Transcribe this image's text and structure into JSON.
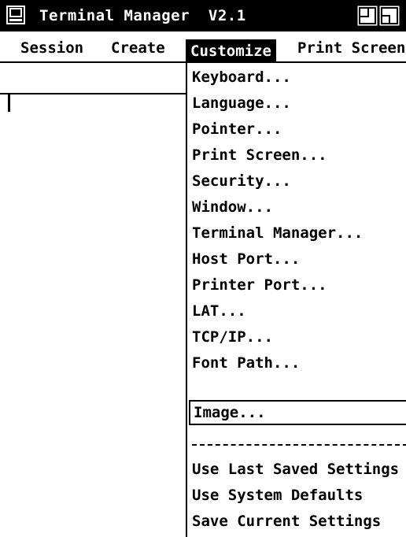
{
  "window": {
    "title": "Terminal Manager  V2.1",
    "icon": "terminal-icon",
    "controls": [
      "restore-icon",
      "maximize-icon"
    ]
  },
  "menubar": {
    "items": [
      {
        "label": "Session"
      },
      {
        "label": "Create"
      },
      {
        "label": "Customize",
        "selected": true
      },
      {
        "label": "Print Screen"
      }
    ]
  },
  "customize_menu": {
    "items": [
      {
        "label": "Keyboard..."
      },
      {
        "label": "Language..."
      },
      {
        "label": "Pointer..."
      },
      {
        "label": "Print Screen..."
      },
      {
        "label": "Security..."
      },
      {
        "label": "Window..."
      },
      {
        "label": "Terminal Manager..."
      },
      {
        "label": "Host Port..."
      },
      {
        "label": "Printer Port..."
      },
      {
        "label": "LAT..."
      },
      {
        "label": "TCP/IP..."
      },
      {
        "label": "Font Path..."
      },
      {
        "label": "Image...",
        "focused": true
      }
    ],
    "settings_items": [
      {
        "label": "Use Last Saved Settings"
      },
      {
        "label": "Use System Defaults"
      },
      {
        "label": "Save Current Settings"
      }
    ]
  },
  "colors": {
    "foreground": "#000000",
    "background": "#ffffff"
  }
}
